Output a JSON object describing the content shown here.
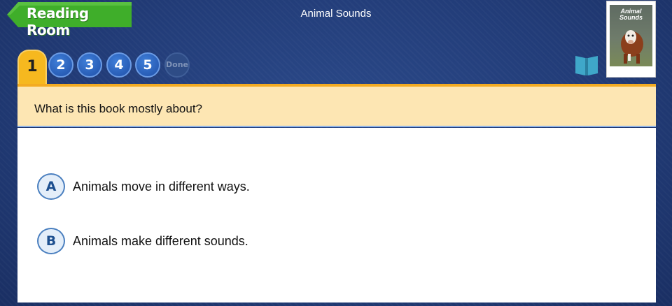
{
  "header": {
    "back_label": "Reading Room",
    "title": "Animal Sounds"
  },
  "book": {
    "cover_title_line1": "Animal",
    "cover_title_line2": "Sounds",
    "cover_image": "cow-photo"
  },
  "tabs": [
    {
      "label": "1",
      "state": "active"
    },
    {
      "label": "2",
      "state": "normal"
    },
    {
      "label": "3",
      "state": "normal"
    },
    {
      "label": "4",
      "state": "normal"
    },
    {
      "label": "5",
      "state": "normal"
    },
    {
      "label": "Done",
      "state": "disabled"
    }
  ],
  "question": {
    "text": "What is this book mostly about?"
  },
  "options": [
    {
      "letter": "A",
      "text": "Animals move in different ways."
    },
    {
      "letter": "B",
      "text": "Animals make different sounds."
    }
  ],
  "icons": {
    "book": "open-book-icon",
    "back": "back-arrow-icon"
  },
  "colors": {
    "background": "#223c78",
    "back_button": "#3fae2a",
    "active_tab": "#f6b81f",
    "question_bar": "#fde6b3",
    "option_border": "#4a7fbf"
  }
}
